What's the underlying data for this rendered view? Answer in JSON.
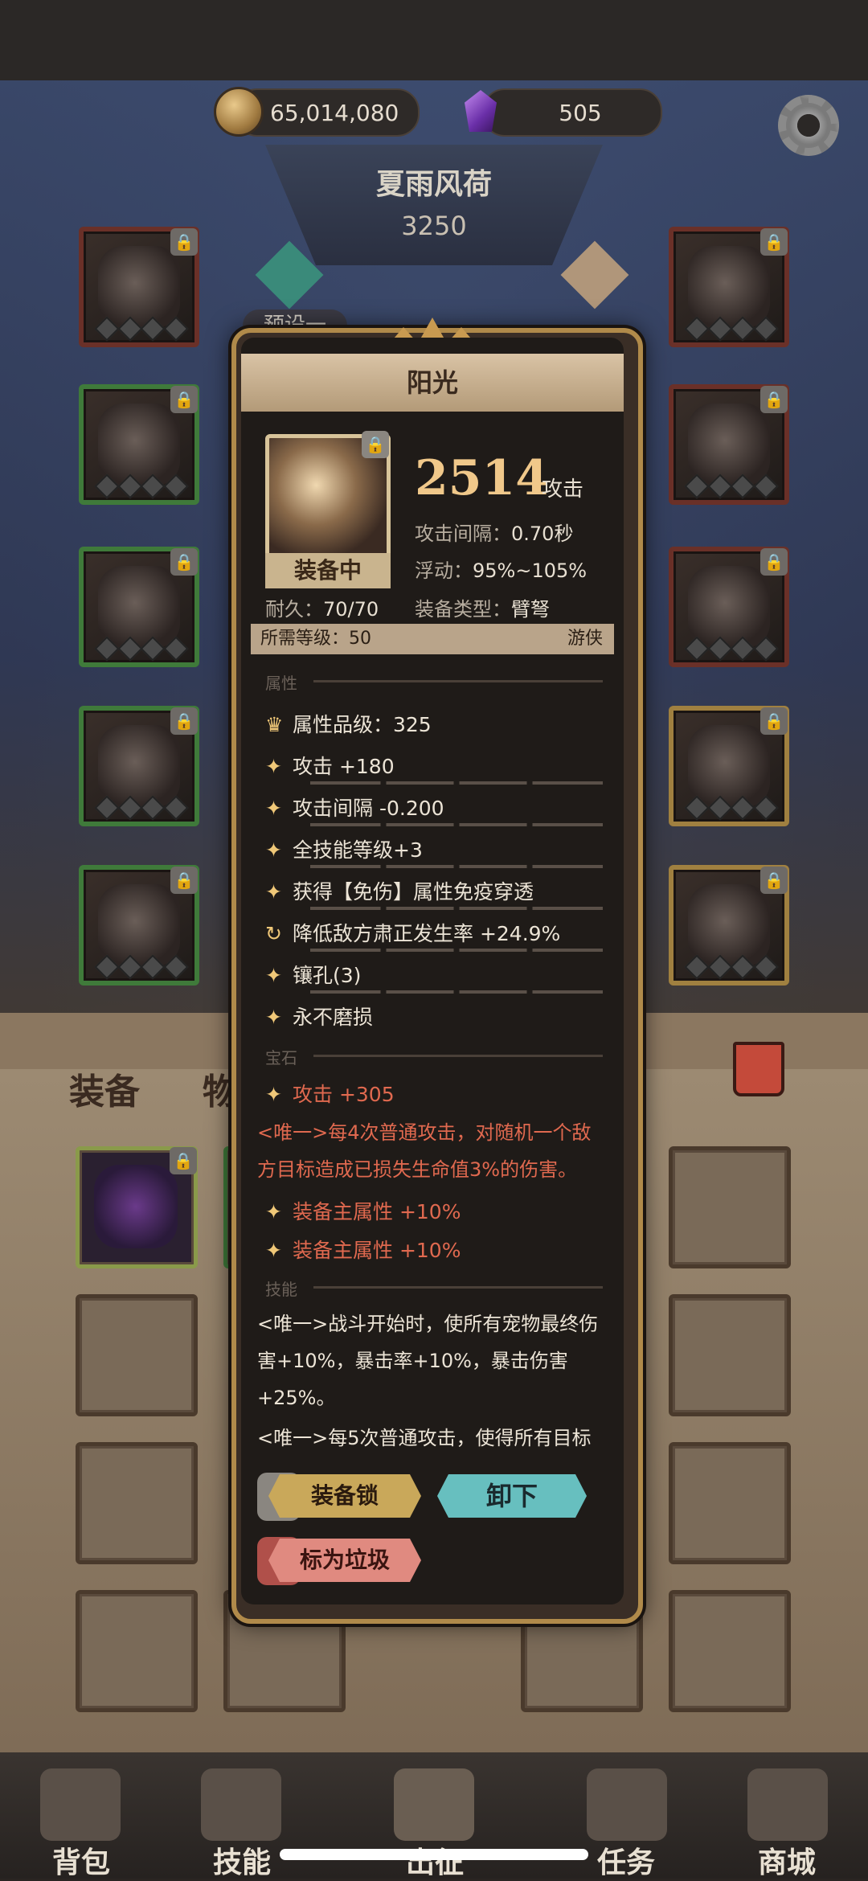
{
  "currency": {
    "coins": "65,014,080",
    "gems": "505"
  },
  "character": {
    "name": "夏雨风荷",
    "power": "3250",
    "preset": "预设一"
  },
  "equipment_tabs": {
    "equip": "装备",
    "items": "物"
  },
  "item": {
    "name": "阳光",
    "attack": "2514",
    "attack_word": "攻击",
    "equipped_badge": "装备中",
    "interval_label": "攻击间隔：",
    "interval_value": "0.70秒",
    "float_label": "浮动：",
    "float_value": "95%~105%",
    "durability_label": "耐久：",
    "durability_value": "70/70",
    "type_label": "装备类型：",
    "type_value": "臂弩",
    "req_level_label": "所需等级：",
    "req_level_value": "50",
    "req_class": "游侠"
  },
  "sections": {
    "attributes": "属性",
    "gems": "宝石",
    "skills": "技能"
  },
  "attributes": [
    "属性品级：325",
    "攻击 +180",
    "攻击间隔 -0.200",
    "全技能等级+3",
    "获得【免伤】属性免疫穿透",
    "降低敌方肃正发生率 +24.9%",
    "镶孔(3)",
    "永不磨损"
  ],
  "gem_stats": {
    "gem1": "攻击 +305",
    "gem_unique": "<唯一>每4次普通攻击，对随机一个敌方目标造成已损失生命值3%的伤害。",
    "gem2": "装备主属性 +10%",
    "gem3": "装备主属性 +10%"
  },
  "skills": {
    "skill1": "<唯一>战斗开始时，使所有宠物最终伤害+10%，暴击率+10%，暴击伤害+25%。",
    "skill2": "<唯一>每5次普通攻击，使得所有目标"
  },
  "buttons": {
    "lock": "装备锁",
    "unequip": "卸下",
    "mark_trash": "标为垃圾"
  },
  "nav": [
    "背包",
    "技能",
    "出征",
    "任务",
    "商城"
  ]
}
